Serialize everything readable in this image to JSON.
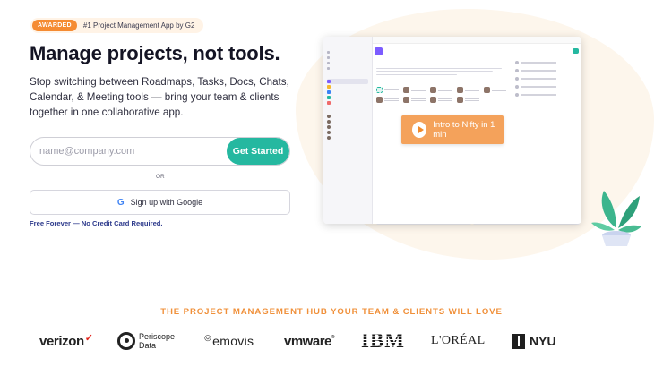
{
  "award": {
    "badge": "AWARDED",
    "text": "#1 Project Management App by G2"
  },
  "hero": {
    "headline": "Manage projects, not tools.",
    "subhead": "Stop switching between Roadmaps, Tasks, Docs, Chats, Calendar, & Meeting tools — bring your team & clients together in one collaborative app."
  },
  "signup": {
    "email_placeholder": "name@company.com",
    "submit_label": "Get Started",
    "or_label": "OR",
    "google_label": "Sign up with Google",
    "google_icon": "G",
    "free_note": "Free Forever — No Credit Card Required."
  },
  "preview": {
    "video_cta": "Intro to Nifty in 1 min",
    "icons": [
      "play-icon",
      "plant-illustration"
    ]
  },
  "trust": {
    "heading": "THE PROJECT MANAGEMENT HUB YOUR TEAM & CLIENTS WILL LOVE",
    "logos": {
      "verizon": "verizon",
      "periscope_top": "Periscope",
      "periscope_bottom": "Data",
      "emovis": "emovis",
      "vmware": "vmware",
      "ibm": "IBM",
      "loreal": "L'ORÉAL",
      "nyu": "NYU"
    }
  },
  "colors": {
    "accent": "#25b8a0",
    "orange": "#f58b32",
    "navy": "#2d3a8c"
  }
}
